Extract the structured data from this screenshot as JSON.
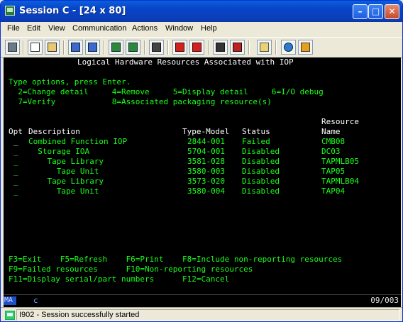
{
  "window": {
    "title": "Session C - [24 x 80]"
  },
  "caption_buttons": {
    "minimize": "–",
    "maximize": "□",
    "close": "✕"
  },
  "menu": [
    {
      "id": "file",
      "label": "File"
    },
    {
      "id": "edit",
      "label": "Edit"
    },
    {
      "id": "view",
      "label": "View"
    },
    {
      "id": "communication",
      "label": "Communication"
    },
    {
      "id": "actions",
      "label": "Actions"
    },
    {
      "id": "window",
      "label": "Window"
    },
    {
      "id": "help",
      "label": "Help"
    }
  ],
  "toolbar": {
    "buttons": [
      "print-screen-icon",
      "copy-icon",
      "paste-icon",
      "send-file-icon",
      "receive-file-icon",
      "display-keypad-icon",
      "quick-settings-icon",
      "keyboard-icon",
      "record-macro-icon",
      "stop-macro-icon",
      "play-macro-icon",
      "run-macro-icon",
      "clipboard-icon",
      "globe-icon",
      "customize-icon"
    ]
  },
  "screen": {
    "heading": "Logical Hardware Resources Associated with IOP",
    "instruction": "Type options, press Enter.",
    "options_line1": "  2=Change detail     4=Remove     5=Display detail     6=I/O debug",
    "options_line2": "  7=Verify            8=Associated packaging resource(s)",
    "col_resource_top": "Resource",
    "col_opt": "Opt",
    "col_description": "Description",
    "col_type_model": "Type-Model",
    "col_status": "Status",
    "col_name": "Name",
    "rows": [
      {
        "opt": "_",
        "description": "Combined Function IOP",
        "type_model": "2844-001",
        "status": "Failed",
        "name": "CMB08"
      },
      {
        "opt": "_",
        "description": "  Storage IOA",
        "type_model": "5704-001",
        "status": "Disabled",
        "name": "DC03"
      },
      {
        "opt": "_",
        "description": "    Tape Library",
        "type_model": "3581-028",
        "status": "Disabled",
        "name": "TAPMLB05"
      },
      {
        "opt": "_",
        "description": "      Tape Unit",
        "type_model": "3580-003",
        "status": "Disabled",
        "name": "TAP05"
      },
      {
        "opt": "_",
        "description": "    Tape Library",
        "type_model": "3573-020",
        "status": "Disabled",
        "name": "TAPMLB04"
      },
      {
        "opt": "_",
        "description": "      Tape Unit",
        "type_model": "3580-004",
        "status": "Disabled",
        "name": "TAP04"
      }
    ],
    "fkeys_line1": "F3=Exit    F5=Refresh    F6=Print    F8=Include non-reporting resources",
    "fkeys_line2": "F9=Failed resources      F10=Non-reporting resources",
    "fkeys_line3": "F11=Display serial/part numbers      F12=Cancel"
  },
  "oia": {
    "mode": "MA",
    "indicator": "c",
    "cursor_position": "09/003"
  },
  "statusbar": {
    "message": "I902 - Session successfully started"
  }
}
